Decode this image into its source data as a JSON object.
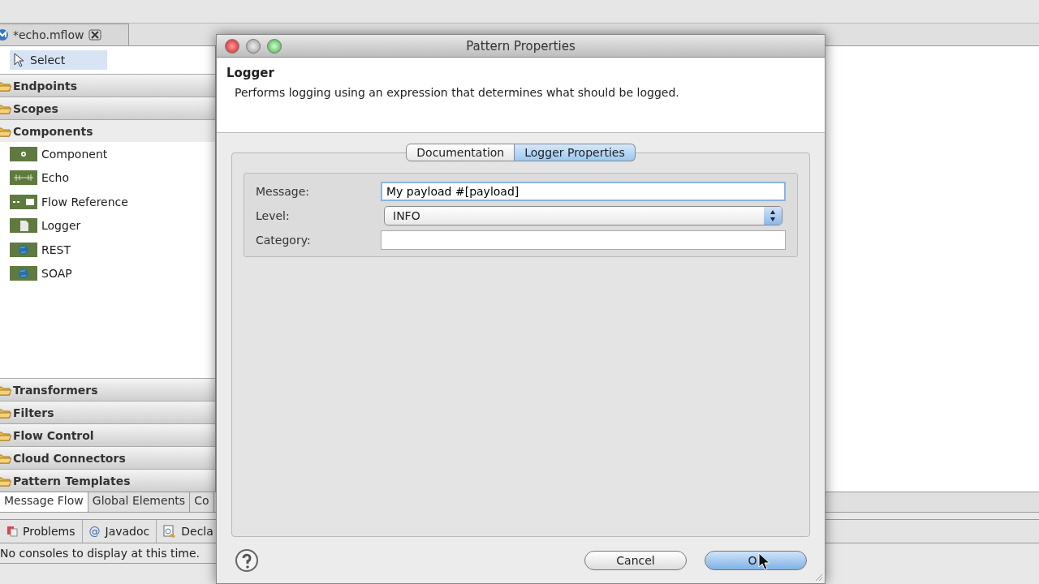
{
  "editor_tab": {
    "label": "*echo.mflow"
  },
  "palette": {
    "select": {
      "label": "Select",
      "selected": true
    },
    "drawers": [
      {
        "label": "Endpoints",
        "expanded": false
      },
      {
        "label": "Scopes",
        "expanded": false
      },
      {
        "label": "Components",
        "expanded": true,
        "children": [
          {
            "label": "Component"
          },
          {
            "label": "Echo"
          },
          {
            "label": "Flow Reference"
          },
          {
            "label": "Logger"
          },
          {
            "label": "REST"
          },
          {
            "label": "SOAP"
          }
        ]
      },
      {
        "label": "Transformers",
        "expanded": false
      },
      {
        "label": "Filters",
        "expanded": false
      },
      {
        "label": "Flow Control",
        "expanded": false
      },
      {
        "label": "Cloud Connectors",
        "expanded": false
      },
      {
        "label": "Pattern Templates",
        "expanded": false
      }
    ]
  },
  "editor_bottom_tabs": [
    {
      "label": "Message Flow",
      "selected": true
    },
    {
      "label": "Global Elements",
      "selected": false
    },
    {
      "label": "Co",
      "selected": false
    }
  ],
  "console_tabs": [
    {
      "label": "Problems"
    },
    {
      "label": "Javadoc",
      "glyph": "@"
    },
    {
      "label": "Decla"
    }
  ],
  "console": {
    "message": "No consoles to display at this time."
  },
  "dialog": {
    "title": "Pattern Properties",
    "heading": "Logger",
    "description": "Performs logging using an expression that determines what should be logged.",
    "tabs": [
      {
        "label": "Documentation",
        "selected": false
      },
      {
        "label": "Logger Properties",
        "selected": true
      }
    ],
    "fields": [
      {
        "kind": "text",
        "label": "Message:",
        "value": "My payload #[payload]",
        "focused": true
      },
      {
        "kind": "select",
        "label": "Level:",
        "value": "INFO"
      },
      {
        "kind": "text",
        "label": "Category:",
        "focused": false
      }
    ],
    "buttons": [
      {
        "label": "Cancel",
        "default": false
      },
      {
        "label": "O",
        "default": true
      }
    ]
  }
}
